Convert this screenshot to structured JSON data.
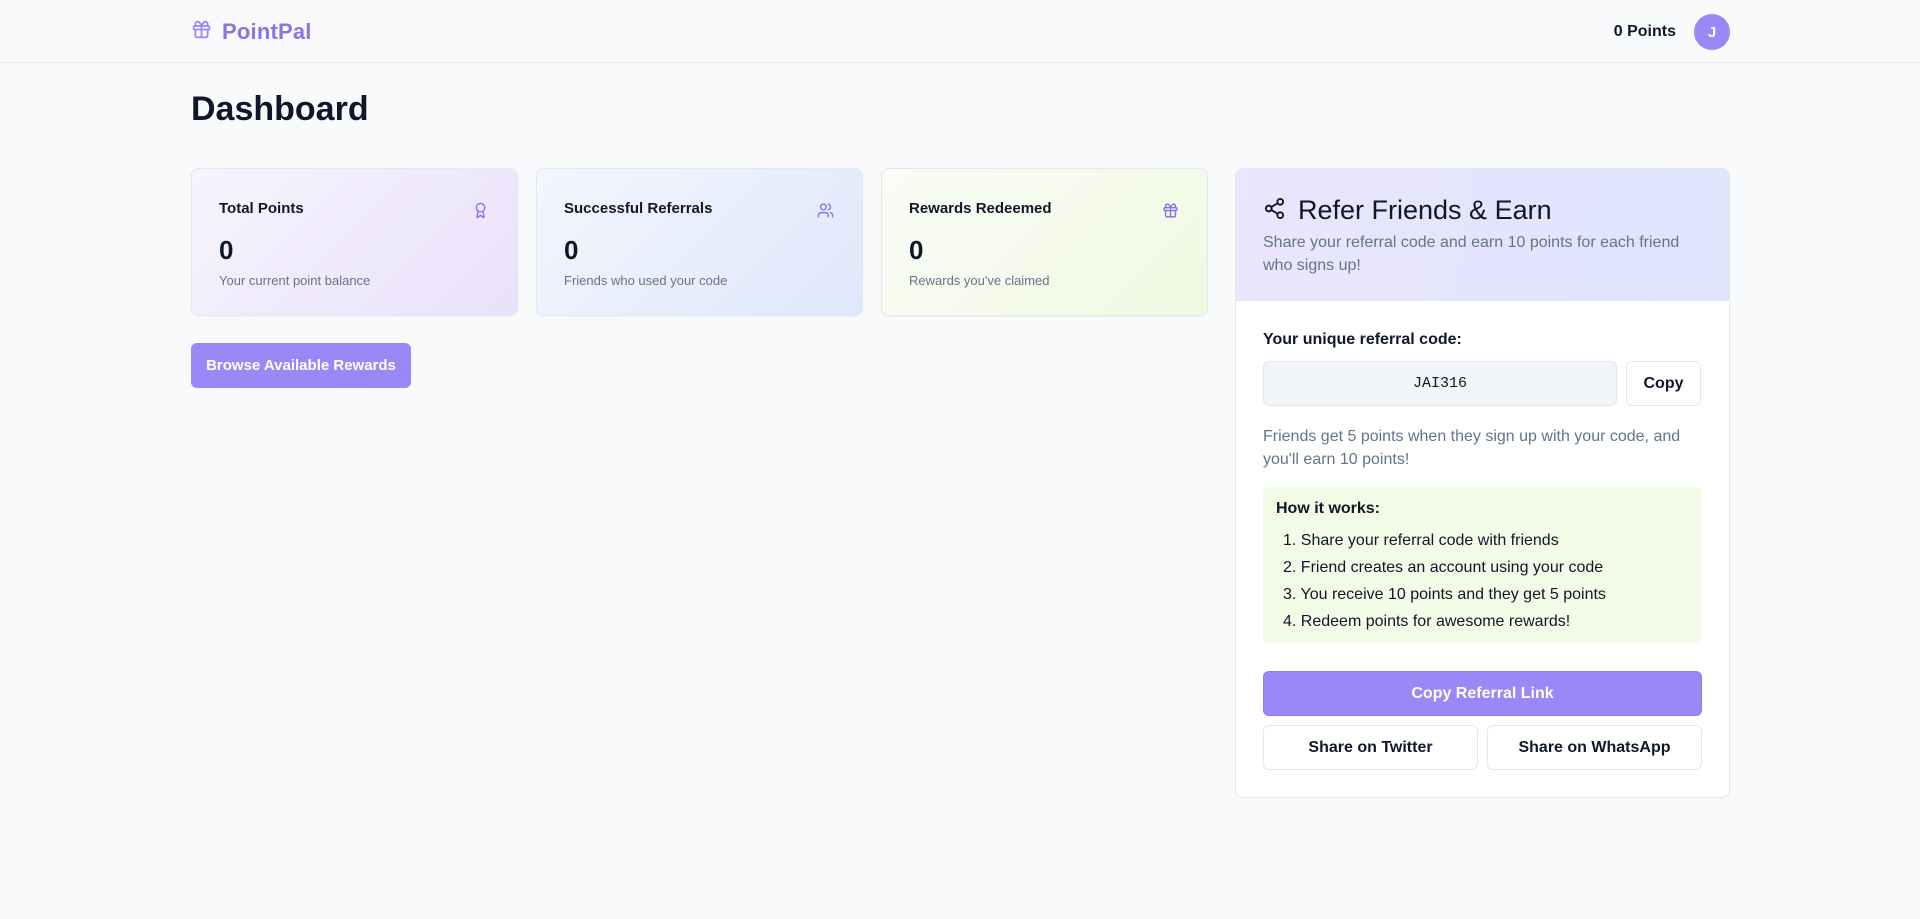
{
  "header": {
    "brand_name": "PointPal",
    "brand_icon": "gift-icon",
    "points_label": "0 Points",
    "avatar_initial": "J"
  },
  "page": {
    "title": "Dashboard"
  },
  "stats": [
    {
      "title": "Total Points",
      "value": "0",
      "subtitle": "Your current point balance",
      "icon": "award-icon"
    },
    {
      "title": "Successful Referrals",
      "value": "0",
      "subtitle": "Friends who used your code",
      "icon": "users-icon"
    },
    {
      "title": "Rewards Redeemed",
      "value": "0",
      "subtitle": "Rewards you've claimed",
      "icon": "gift-icon"
    }
  ],
  "actions": {
    "browse_rewards": "Browse Available Rewards"
  },
  "referral": {
    "title": "Refer Friends & Earn",
    "icon": "share-icon",
    "description": "Share your referral code and earn 10 points for each friend who signs up!",
    "code_label": "Your unique referral code:",
    "code": "JAI316",
    "copy_label": "Copy",
    "friends_note": "Friends get 5 points when they sign up with your code, and you'll earn 10 points!",
    "how_title": "How it works:",
    "how_steps": [
      "1. Share your referral code with friends",
      "2. Friend creates an account using your code",
      "3. You receive 10 points and they get 5 points",
      "4. Redeem points for awesome rewards!"
    ],
    "copy_link_label": "Copy Referral Link",
    "share_twitter_label": "Share on Twitter",
    "share_whatsapp_label": "Share on WhatsApp"
  },
  "colors": {
    "accent": "#9b87f5",
    "brand_text": "#8b74e6",
    "muted_text": "#64748b",
    "how_box_bg": "#f2fbe6"
  }
}
